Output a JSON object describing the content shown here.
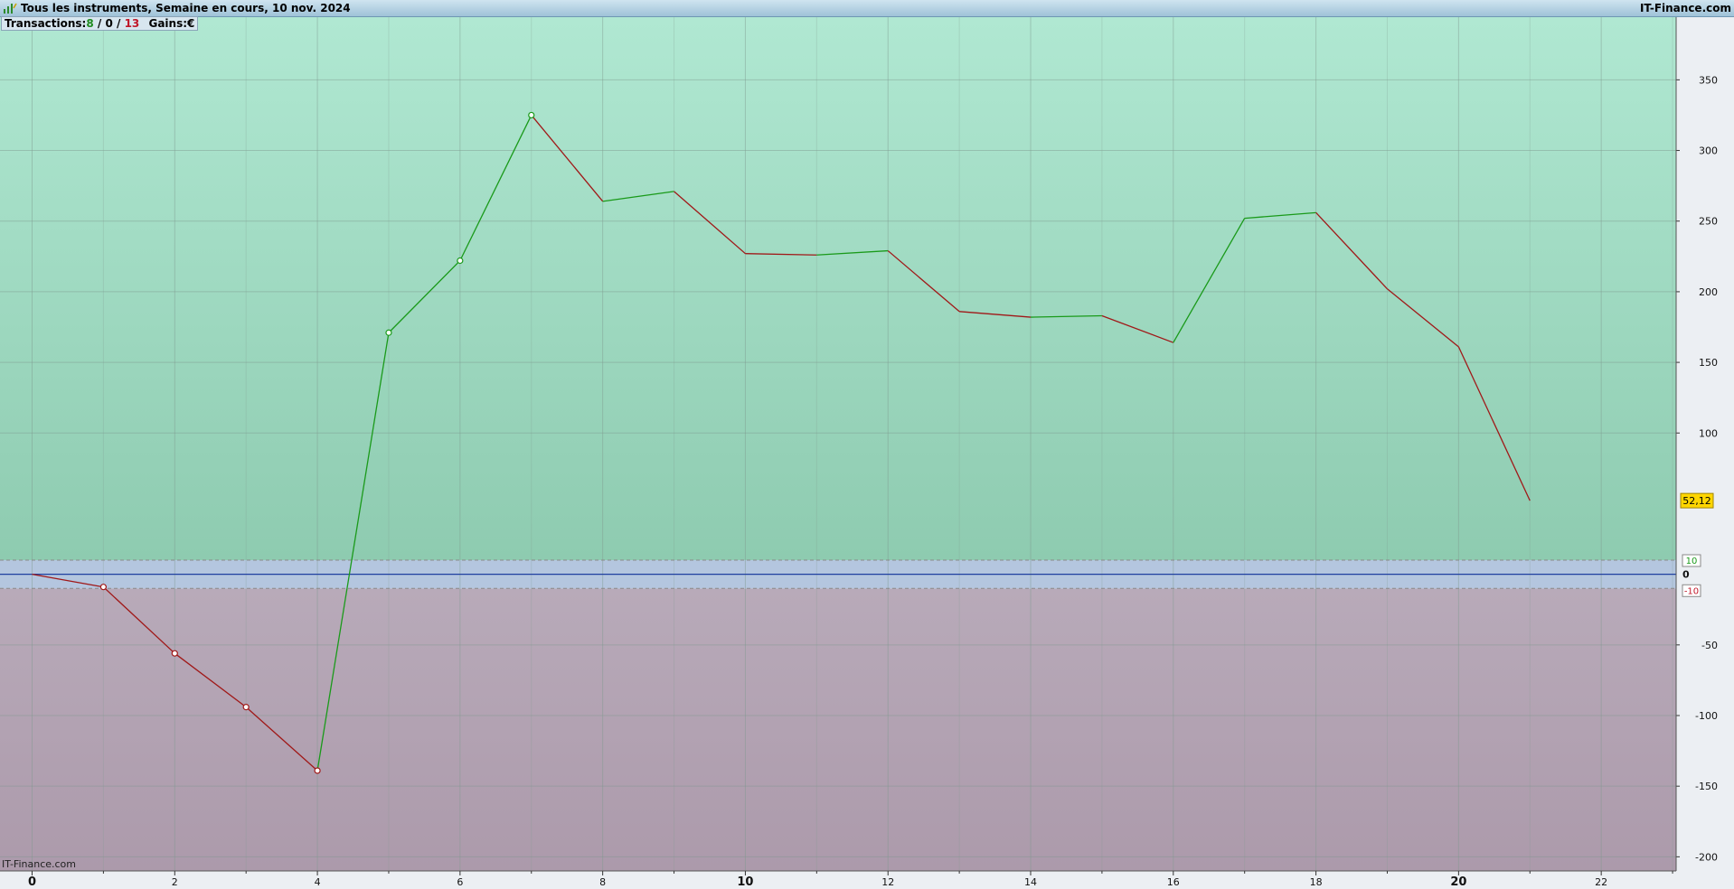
{
  "header": {
    "title": "Tous les instruments, Semaine en cours, 10 nov. 2024",
    "brand": "IT-Finance.com"
  },
  "stats": {
    "transactions_label": "Transactions:",
    "wins": "8",
    "sep1": " / ",
    "neutral": "0",
    "sep2": " / ",
    "losses": "13",
    "gains_label": "Gains:",
    "currency": "€"
  },
  "watermark": "IT-Finance.com",
  "colors": {
    "positive_zone": "#a9e2ca",
    "negative_zone": "#b3a4b3",
    "neutral_band": "#b4c6df",
    "up_line": "#1a9a1a",
    "down_line": "#a01818",
    "zero_line": "#1f3fa0",
    "last_value_bg": "#ffd600"
  },
  "chart_data": {
    "type": "line",
    "x": [
      0,
      1,
      2,
      3,
      4,
      5,
      6,
      7,
      8,
      9,
      10,
      11,
      12,
      13,
      14,
      15,
      16,
      17,
      18,
      19,
      20,
      21
    ],
    "y": [
      0,
      -9,
      -56,
      -94,
      -139,
      171,
      222,
      325,
      264,
      271,
      227,
      226,
      229,
      186,
      182,
      183,
      164,
      252,
      256,
      202,
      161,
      52.12
    ],
    "markers": [
      1,
      2,
      3,
      4,
      5,
      6,
      7
    ],
    "xlim": [
      -0.45,
      23.05
    ],
    "ylim": [
      -210,
      395
    ],
    "x_ticks": [
      0,
      2,
      4,
      6,
      8,
      10,
      12,
      14,
      16,
      18,
      20,
      22
    ],
    "x_major": [
      0,
      10,
      20
    ],
    "y_ticks": [
      350,
      300,
      250,
      200,
      150,
      100,
      -50,
      -100,
      -150,
      -200
    ],
    "zero_label": "0",
    "band_upper": 10,
    "band_lower": -10,
    "band_upper_label": "10",
    "band_lower_label": "-10",
    "last_value": "52,12",
    "grid": true
  }
}
